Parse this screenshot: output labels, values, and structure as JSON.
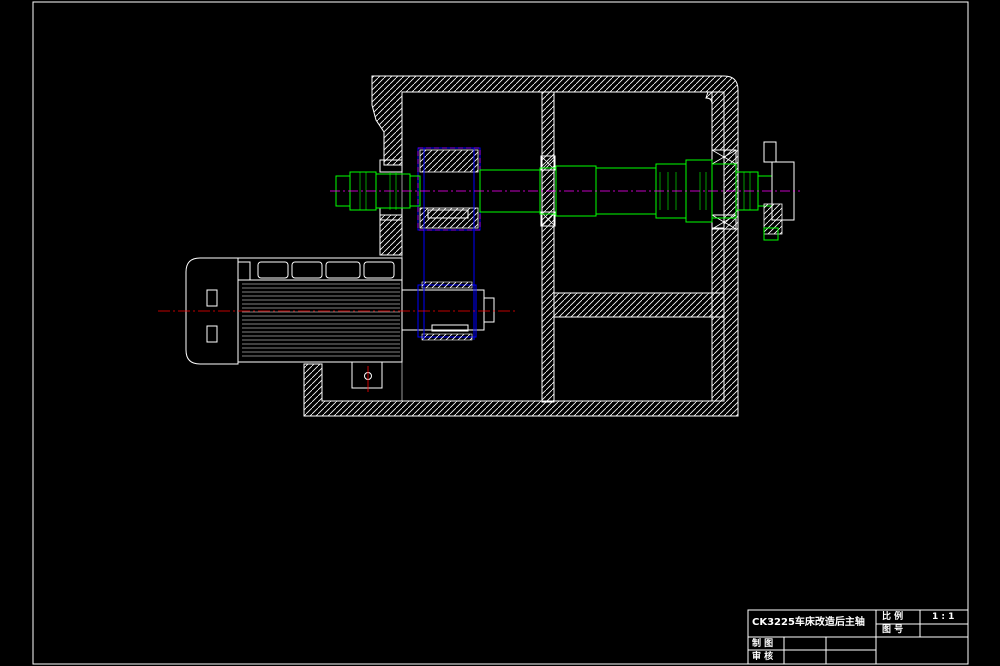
{
  "title_block": {
    "drawing_title": "CK3225车床改造后主轴",
    "scale_label": "比 例",
    "scale_value": "1 : 1",
    "drawing_no_label": "图 号",
    "drawn_by_label": "制 图",
    "checked_by_label": "审 核"
  },
  "colors": {
    "background": "#000000",
    "outline": "#ffffff",
    "shaft": "#00ff00",
    "centerline": "#ff0000",
    "gear": "#0000ff",
    "gear_hidden": "#ff00ff"
  }
}
